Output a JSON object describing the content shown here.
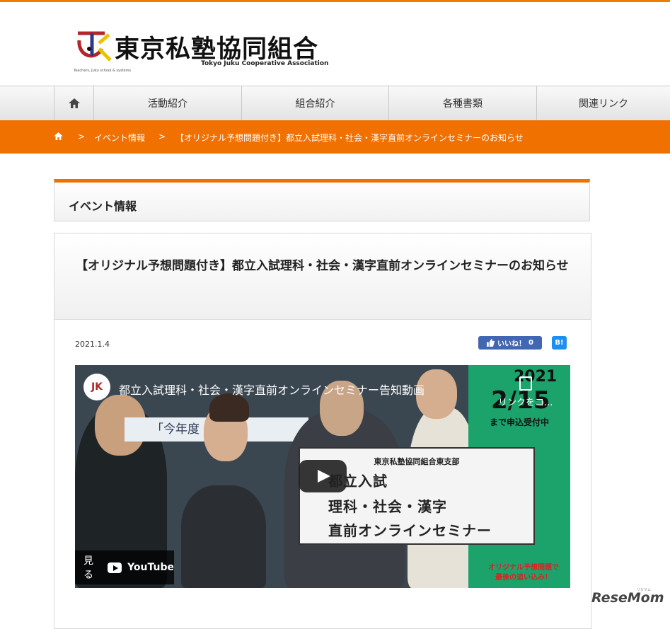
{
  "header": {
    "logo_title": "東京私塾協同組合",
    "logo_subtitle": "Tokyo Juku Cooperative Association",
    "logo_tagline": "Teachers, Juku school & systems"
  },
  "nav": {
    "items": [
      {
        "label": "活動紹介"
      },
      {
        "label": "組合紹介"
      },
      {
        "label": "各種書類"
      },
      {
        "label": "関連リンク"
      }
    ]
  },
  "breadcrumb": {
    "items": [
      "イベント情報",
      "【オリジナル予想問題付き】都立入試理科・社会・漢字直前オンラインセミナーのお知らせ"
    ]
  },
  "section": {
    "title": "イベント情報"
  },
  "article": {
    "title": "【オリジナル予想問題付き】都立入試理科・社会・漢字直前オンラインセミナーのお知らせ",
    "date": "2021.1.4",
    "fb_label": "いいね！",
    "fb_count": "0",
    "hatena_label": "B!"
  },
  "video": {
    "title": "都立入試理科・社会・漢字直前オンラインセミナー告知動画",
    "copy_link": "リンクをコ...",
    "year": "2021",
    "deadline_date": "2/15",
    "deadline_text": "まで申込受付中",
    "box_org": "東京私塾協同組合東支部",
    "box_line1": "都立入試",
    "box_line2": "理科・社会・漢字",
    "box_line3": "直前オンラインセミナー",
    "promo_line1": "オリジナル予想問題で",
    "promo_line2": "最後の追い込み！",
    "banner_text": "「今年度",
    "watch_label": "見る",
    "youtube_label": "YouTube"
  },
  "watermark": {
    "brand": "ReseMom",
    "small": "リセマム"
  },
  "colors": {
    "accent": "#f07100",
    "facebook": "#4267b2",
    "hatena": "#1d8ff0",
    "video_green": "#1ca36b"
  }
}
